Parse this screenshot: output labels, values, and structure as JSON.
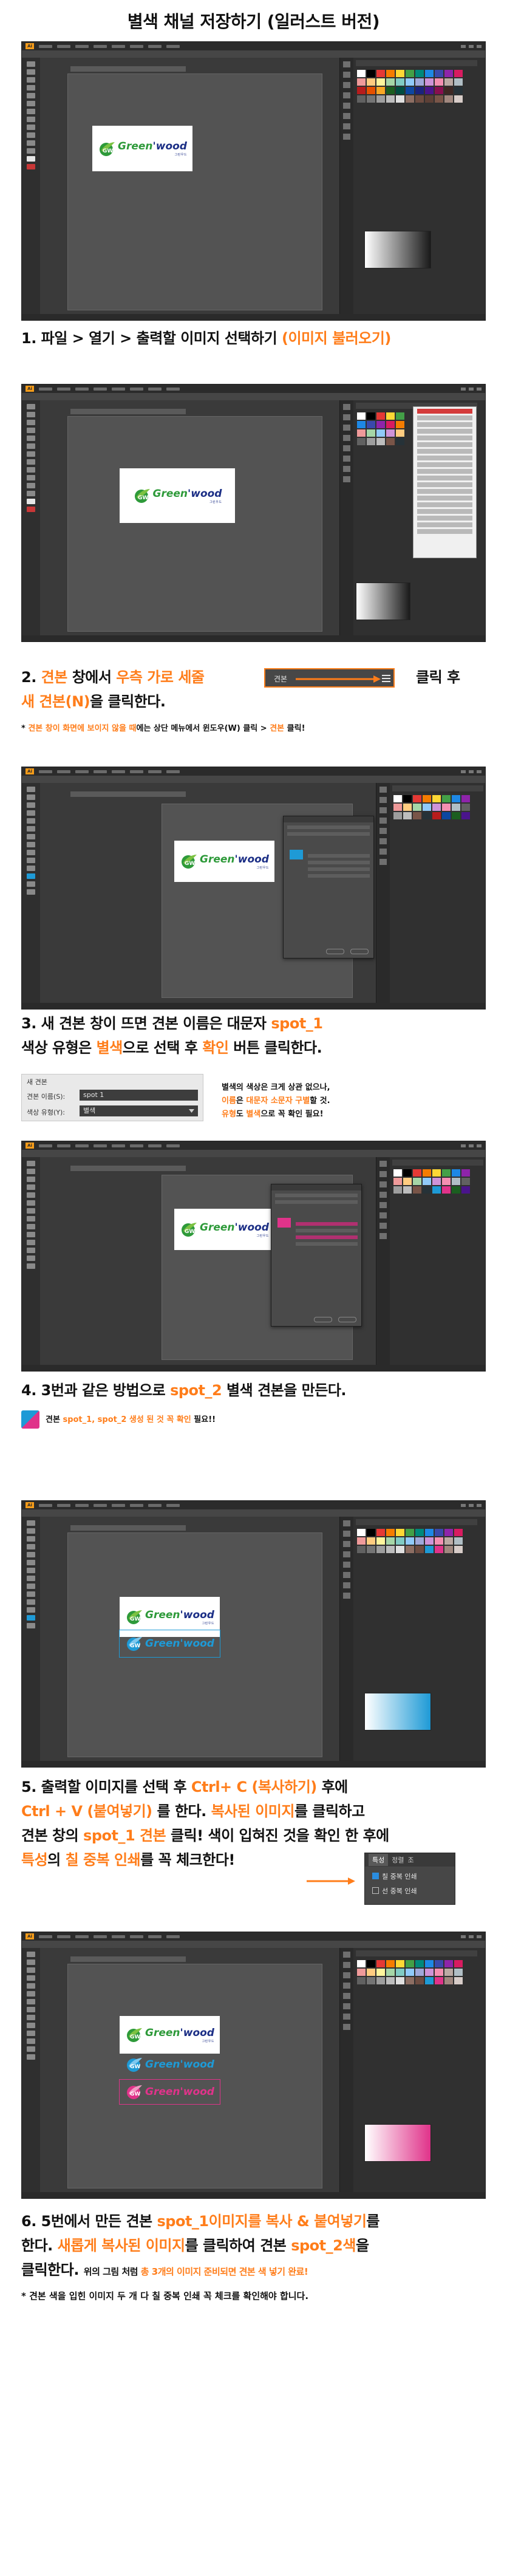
{
  "title": "별색 채널 저장하기 (일러스트 버전)",
  "steps": [
    {
      "id": "1",
      "caption_parts": [
        {
          "t": "1. 파일 > 열기 > 출력할 이미지 선택하기 ",
          "c": "k"
        },
        {
          "t": "(이미지 불러오기)",
          "c": "o"
        }
      ]
    },
    {
      "id": "2",
      "caption_line1_a": "2. ",
      "caption_line1_b": "견본",
      "caption_line1_c": " 창에서 ",
      "caption_line1_d": "우측 가로 세줄",
      "caption_line1_e": " 클릭 후",
      "caption_line2_a": "새 견본(N)",
      "caption_line2_b": "을 클릭한다.",
      "callout_label": "견본",
      "note_a": "* ",
      "note_b": "견본 창이 화면에 보이지 않을 때",
      "note_c": "에는 상단 메뉴에서 윈도우(W) 클릭 > ",
      "note_d": "견본",
      "note_e": " 클릭!"
    },
    {
      "id": "3",
      "caption_line1_a": "3. 새 견본 창이 뜨면 견본 이름은 대문자 ",
      "caption_line1_b": "spot_1",
      "caption_line2_a": "색상 유형은 ",
      "caption_line2_b": "별색",
      "caption_line2_c": "으로 선택 후 ",
      "caption_line2_d": "확인",
      "caption_line2_e": " 버튼 클릭한다.",
      "dialog_title": "새 견본",
      "field_name_label": "견본 이름(S):",
      "field_name_value": "spot 1",
      "field_type_label": "색상 유형(Y):",
      "field_type_value": "별색",
      "side_note_1": "별색의 색상은 크게 상관 없으나,",
      "side_note_2a": "이름",
      "side_note_2b": "은 ",
      "side_note_2c": "대문자 소문자 구별",
      "side_note_2d": "할 것.",
      "side_note_3a": "유형",
      "side_note_3b": "도 ",
      "side_note_3c": "별색",
      "side_note_3d": "으로 꼭 확인 필요!"
    },
    {
      "id": "4",
      "caption_a": "4. 3번과 같은 방법으로 ",
      "caption_b": "spot_2",
      "caption_c": " 별색 견본을 만든다.",
      "note_a": "견본 ",
      "note_b": "spot_1, spot_2 생성 된 것 꼭 확인",
      "note_c": " 필요!!"
    },
    {
      "id": "5",
      "l1_a": "5. 출력할 이미지를 선택 후 ",
      "l1_b": "Ctrl+ C (복사하기)",
      "l1_c": " 후에",
      "l2_a": "Ctrl + V (붙여넣기)",
      "l2_b": " 를 한다. ",
      "l2_c": "복사된 이미지",
      "l2_d": "를 클릭하고",
      "l3_a": "견본 창의 ",
      "l3_b": "spot_1 견본",
      "l3_c": " 클릭! 색이 입혀진 것을 확인 한 후에",
      "l4_a": "특성",
      "l4_b": "의 ",
      "l4_c": "칠 중복 인쇄",
      "l4_d": "를 꼭 체크한다!",
      "panel_tab1": "특성",
      "panel_tab2": "정렬",
      "panel_tab3": "조",
      "panel_check1": "칠 중복 인쇄",
      "panel_check2": "선 중복 인쇄"
    },
    {
      "id": "6",
      "l1_a": "6. 5번에서 만든 견본 ",
      "l1_b": "spot_1이미지를 복사 & 붙여넣기",
      "l1_c": "를",
      "l2_a": "한다. ",
      "l2_b": "새롭게 복사된 이미지",
      "l2_c": "를 클릭하여 견본 ",
      "l2_d": "spot_2색",
      "l2_e": "을",
      "l3_a": "클릭한다. ",
      "l3_b": "위의 그림 처럼 ",
      "l3_c": "총 3개의 이미지 준비되면 견본 색 넣기 완료!",
      "l4": "* 견본 색을 입힌 이미지 두 개 다 칠 중복 인쇄 꼭 체크를 확인해야 합니다."
    }
  ],
  "logo": {
    "green": "Green",
    "wood": "wood",
    "sub": "그린우드"
  },
  "colors": {
    "accent": "#ff7d1a",
    "spot1": "#1e9ad6",
    "spot2": "#e0338a",
    "logo_green": "#2e9a3a",
    "logo_navy": "#1c2f86"
  }
}
